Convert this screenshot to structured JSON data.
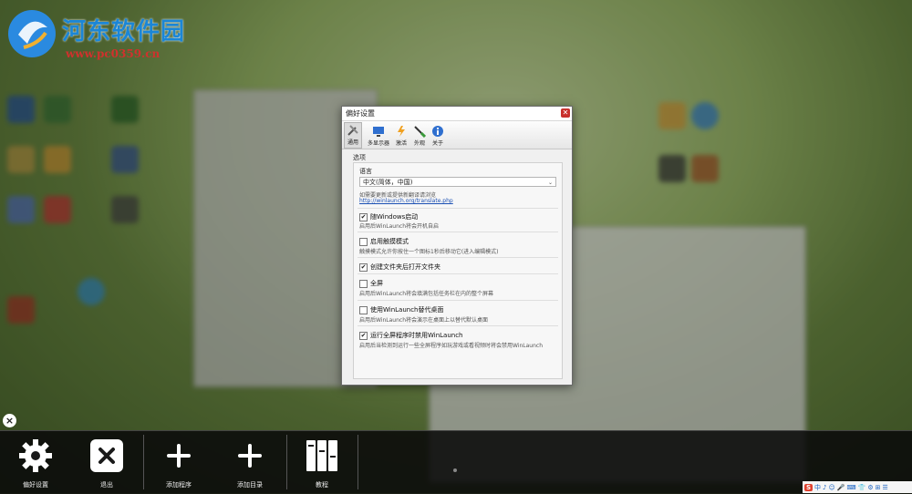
{
  "watermark": {
    "title": "河东软件园",
    "url": "www.pc0359.cn"
  },
  "dialog": {
    "title": "偏好设置",
    "close_icon": "close-icon",
    "toolbar": [
      {
        "label": "通用",
        "icon": "general-tools-icon",
        "active": true
      },
      {
        "label": "多显示器",
        "icon": "monitor-icon",
        "active": false
      },
      {
        "label": "激活",
        "icon": "activate-icon",
        "active": false
      },
      {
        "label": "外观",
        "icon": "appearance-brush-icon",
        "active": false
      },
      {
        "label": "关于",
        "icon": "info-icon",
        "active": false
      }
    ],
    "section_title": "选项",
    "language_label": "语言",
    "language_value": "中文(简体，中国)",
    "language_hint": "如需要更新或提供新翻译请浏览",
    "language_link": "http://winlaunch.org/translate.php",
    "options": [
      {
        "label": "随Windows启动",
        "desc": "启用后WinLaunch将会开机自启",
        "checked": true
      },
      {
        "label": "启用触摸模式",
        "desc": "触摸模式允许你按住一个图标1秒后移动它(进入编辑模式)",
        "checked": false
      },
      {
        "label": "创建文件夹后打开文件夹",
        "desc": "",
        "checked": true
      },
      {
        "label": "全屏",
        "desc": "启用后WinLaunch将会填满包括任务栏在内的整个屏幕",
        "checked": false
      },
      {
        "label": "使用WinLaunch替代桌面",
        "desc": "启用后WinLaunch将会演示在桌面上以替代默认桌面",
        "checked": false
      },
      {
        "label": "运行全屏程序时禁用WinLaunch",
        "desc": "启用后当检测到运行一些全屏程序如玩游戏或看视频时将会禁用WinLaunch",
        "checked": true
      }
    ]
  },
  "launchbar": {
    "items": [
      {
        "label": "偏好设置",
        "icon": "gear-icon"
      },
      {
        "label": "退出",
        "icon": "exit-x-icon"
      },
      {
        "label": "添加程序",
        "icon": "plus-icon"
      },
      {
        "label": "添加目录",
        "icon": "plus-icon"
      },
      {
        "label": "教程",
        "icon": "books-icon"
      }
    ]
  },
  "tray": {
    "items": [
      "S",
      "中",
      "♪",
      "☺",
      "🎤",
      "⌨",
      "👕",
      "⚙",
      "⊞",
      "☰"
    ]
  },
  "colors": {
    "brand_blue": "#1b86d6",
    "brand_red": "#d0312d",
    "close_red": "#c9302c",
    "bar_bg": "#0a0a0a"
  }
}
